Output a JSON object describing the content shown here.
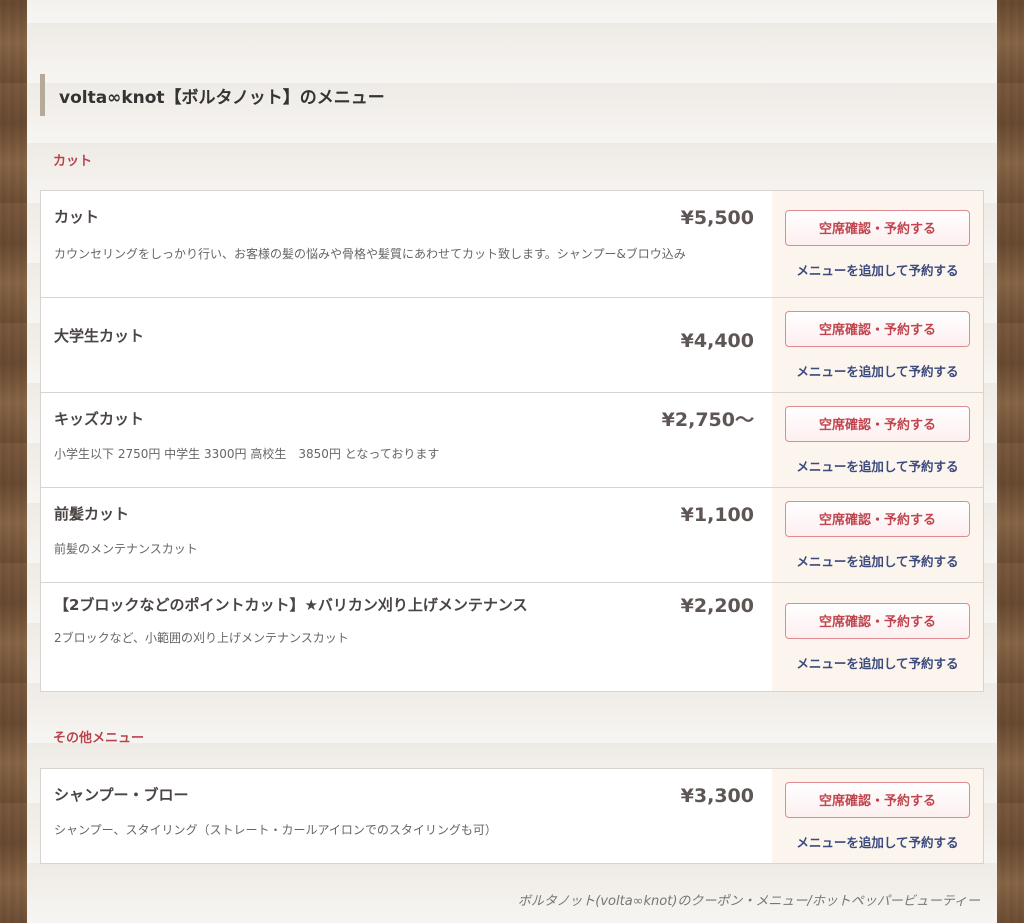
{
  "header": {
    "title": "volta∞knot【ボルタノット】のメニュー"
  },
  "categories": [
    {
      "label": "カット",
      "items": [
        {
          "name": "カット",
          "price": "¥5,500",
          "desc": "カウンセリングをしっかり行い、お客様の髪の悩みや骨格や髪質にあわせてカット致します。シャンプー&ブロウ込み"
        },
        {
          "name": "大学生カット",
          "price": "¥4,400",
          "desc": ""
        },
        {
          "name": "キッズカット",
          "price": "¥2,750〜",
          "desc": "小学生以下 2750円 中学生 3300円 高校生　3850円 となっております"
        },
        {
          "name": "前髪カット",
          "price": "¥1,100",
          "desc": "前髪のメンテナンスカット"
        },
        {
          "name": "【2ブロックなどのポイントカット】★バリカン刈り上げメンテナンス",
          "price": "¥2,200",
          "desc": "2ブロックなど、小範囲の刈り上げメンテナンスカット"
        }
      ]
    },
    {
      "label": "その他メニュー",
      "items": [
        {
          "name": "シャンプー・ブロー",
          "price": "¥3,300",
          "desc": "シャンプー、スタイリング（ストレート・カールアイロンでのスタイリングも可）"
        }
      ]
    }
  ],
  "actions": {
    "reserve_label": "空席確認・予約する",
    "add_menu_label": "メニューを追加して予約する"
  },
  "footer": {
    "note": "ボルタノット(volta∞knot)のクーポン・メニュー/ホットペッパービューティー"
  }
}
